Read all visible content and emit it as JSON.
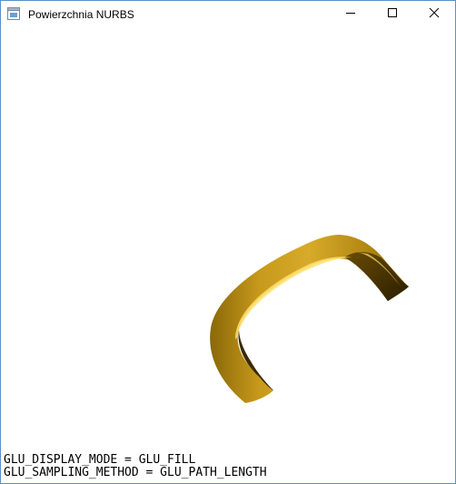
{
  "window": {
    "title": "Powierzchnia NURBS",
    "app_icon": "opengl-window-icon",
    "controls": {
      "minimize_icon": "minimize-icon",
      "maximize_icon": "maximize-icon",
      "close_icon": "close-icon"
    }
  },
  "scene": {
    "object": "nurbs-surface",
    "surface_color": "#c89a1c",
    "shadow_color": "#3a2a00",
    "highlight_color": "#ffe070"
  },
  "status": {
    "display_mode": "GLU_DISPLAY_MODE = GLU_FILL",
    "sampling_method": "GLU_SAMPLING_METHOD = GLU_PATH_LENGTH"
  }
}
